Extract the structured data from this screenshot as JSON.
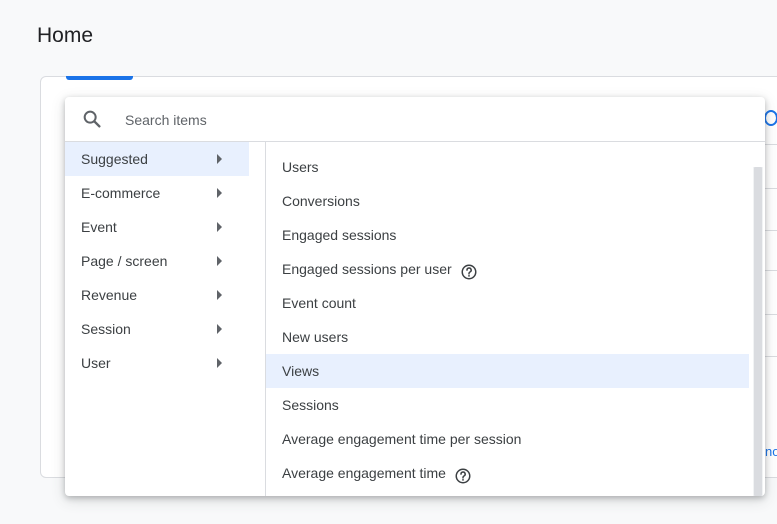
{
  "page": {
    "title": "Home"
  },
  "background": {
    "link_fragment": "no"
  },
  "search": {
    "placeholder": "Search items",
    "value": "",
    "icon": "search-icon"
  },
  "categories": [
    {
      "label": "Suggested",
      "selected": true
    },
    {
      "label": "E-commerce",
      "selected": false
    },
    {
      "label": "Event",
      "selected": false
    },
    {
      "label": "Page / screen",
      "selected": false
    },
    {
      "label": "Revenue",
      "selected": false
    },
    {
      "label": "Session",
      "selected": false
    },
    {
      "label": "User",
      "selected": false
    }
  ],
  "metrics": [
    {
      "label": "Users",
      "help": false,
      "highlighted": false
    },
    {
      "label": "Conversions",
      "help": false,
      "highlighted": false
    },
    {
      "label": "Engaged sessions",
      "help": false,
      "highlighted": false
    },
    {
      "label": "Engaged sessions per user",
      "help": true,
      "highlighted": false
    },
    {
      "label": "Event count",
      "help": false,
      "highlighted": false
    },
    {
      "label": "New users",
      "help": false,
      "highlighted": false
    },
    {
      "label": "Views",
      "help": false,
      "highlighted": true
    },
    {
      "label": "Sessions",
      "help": false,
      "highlighted": false
    },
    {
      "label": "Average engagement time per session",
      "help": false,
      "highlighted": false
    },
    {
      "label": "Average engagement time",
      "help": true,
      "highlighted": false
    }
  ],
  "colors": {
    "accent": "#1a73e8",
    "selected_bg": "#e8f0fe",
    "text": "#3c4043",
    "divider": "#dadce0"
  }
}
